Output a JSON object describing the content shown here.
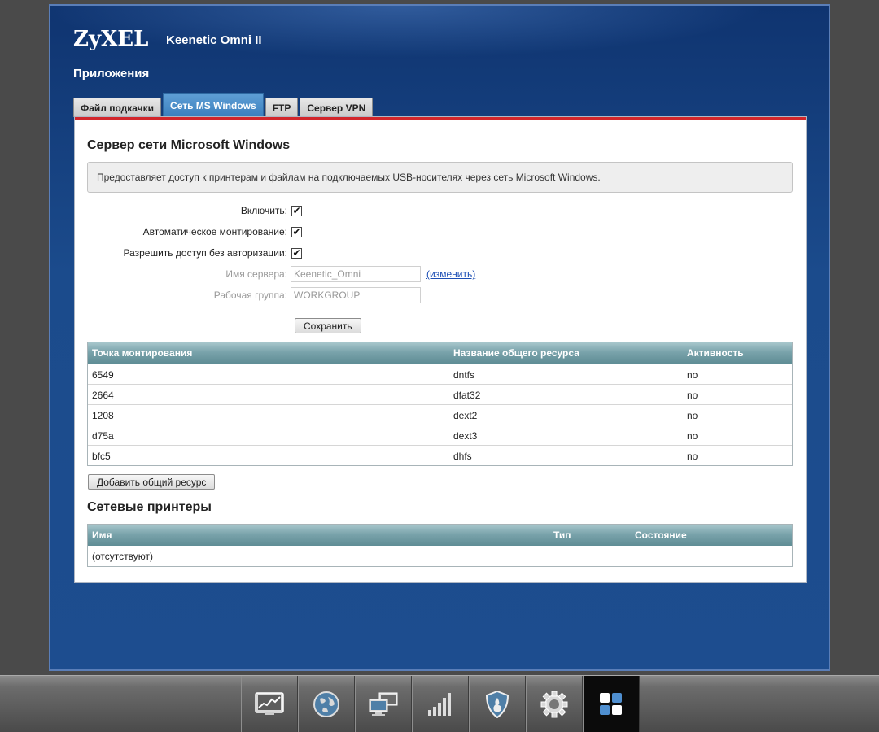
{
  "header": {
    "brand": "ZyXEL",
    "model": "Keenetic Omni II",
    "page_title": "Приложения"
  },
  "tabs": [
    {
      "label": "Файл подкачки",
      "active": false
    },
    {
      "label": "Сеть MS Windows",
      "active": true
    },
    {
      "label": "FTP",
      "active": false
    },
    {
      "label": "Сервер VPN",
      "active": false
    }
  ],
  "server": {
    "title": "Сервер сети Microsoft Windows",
    "description": "Предоставляет доступ к принтерам и файлам на подключаемых USB-носителях через сеть Microsoft Windows.",
    "enable_label": "Включить:",
    "automount_label": "Автоматическое монтирование:",
    "noauth_label": "Разрешить доступ без авторизации:",
    "servername_label": "Имя сервера:",
    "servername_value": "Keenetic_Omni",
    "change_link": "(изменить)",
    "workgroup_label": "Рабочая группа:",
    "workgroup_value": "WORKGROUP",
    "save_label": "Сохранить"
  },
  "shares": {
    "headers": [
      "Точка монтирования",
      "Название общего ресурса",
      "Активность"
    ],
    "rows": [
      [
        "6549",
        "dntfs",
        "no"
      ],
      [
        "2664",
        "dfat32",
        "no"
      ],
      [
        "1208",
        "dext2",
        "no"
      ],
      [
        "d75a",
        "dext3",
        "no"
      ],
      [
        "bfc5",
        "dhfs",
        "no"
      ]
    ],
    "add_label": "Добавить общий ресурс"
  },
  "printers": {
    "title": "Сетевые принтеры",
    "headers": [
      "Имя",
      "Тип",
      "Состояние"
    ],
    "empty": "(отсутствуют)"
  },
  "dock": {
    "items": [
      "monitor-chart-icon",
      "globe-icon",
      "network-computers-icon",
      "signal-bars-icon",
      "shield-icon",
      "gear-icon",
      "apps-grid-icon"
    ],
    "active": "apps-grid-icon"
  }
}
